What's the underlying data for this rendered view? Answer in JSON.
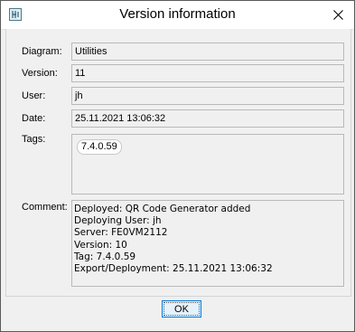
{
  "window": {
    "title": "Version information",
    "icon": "app-logo-icon",
    "close_icon": "close-icon"
  },
  "fields": {
    "diagram": {
      "label": "Diagram:",
      "value": "Utilities"
    },
    "version": {
      "label": "Version:",
      "value": "11"
    },
    "user": {
      "label": "User:",
      "value": "jh"
    },
    "date": {
      "label": "Date:",
      "value": "25.11.2021 13:06:32"
    }
  },
  "tags": {
    "label": "Tags:",
    "items": [
      "7.4.0.59"
    ]
  },
  "comment": {
    "label": "Comment:",
    "lines": [
      "Deployed: QR Code Generator added",
      "Deploying User: jh",
      "Server: FE0VM2112",
      "Version: 10",
      "Tag: 7.4.0.59",
      "Export/Deployment: 25.11.2021 13:06:32"
    ]
  },
  "footer": {
    "ok_label": "OK",
    "accent_color": "#0078d7"
  }
}
